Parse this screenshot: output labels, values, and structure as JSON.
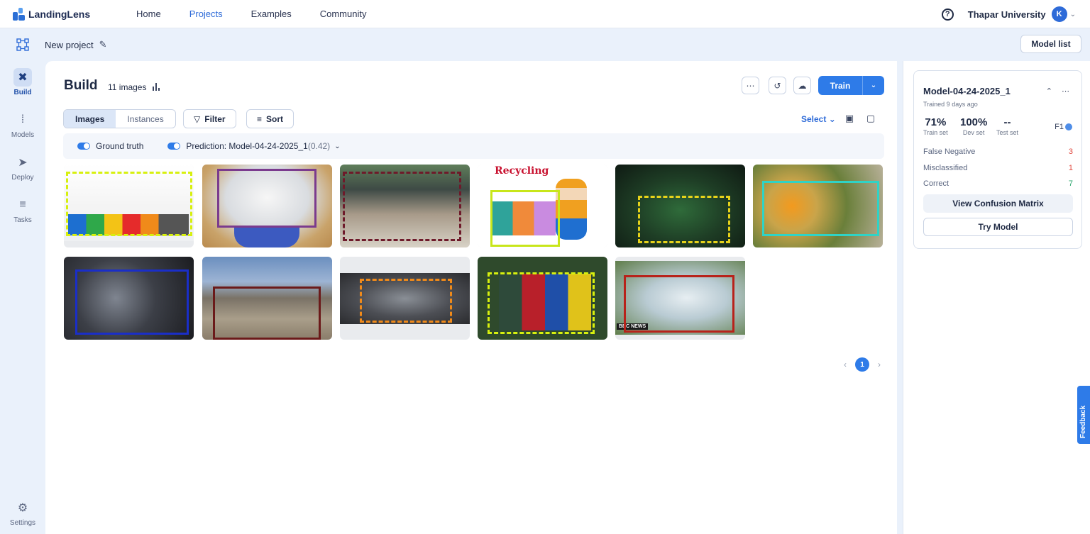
{
  "app": {
    "logo_text": "LandingLens",
    "nav": [
      "Home",
      "Projects",
      "Examples",
      "Community"
    ],
    "active_nav": "Projects",
    "org": "Thapar University",
    "avatar_initial": "K",
    "help_glyph": "?"
  },
  "project": {
    "name": "New project",
    "model_list_label": "Model list"
  },
  "sidebar": {
    "items": [
      {
        "label": "Build",
        "icon": "tools-icon",
        "active": true
      },
      {
        "label": "Models",
        "icon": "nodes-icon",
        "active": false
      },
      {
        "label": "Deploy",
        "icon": "rocket-icon",
        "active": false
      },
      {
        "label": "Tasks",
        "icon": "tasks-icon",
        "active": false
      }
    ],
    "settings_label": "Settings"
  },
  "build": {
    "title": "Build",
    "image_count": "11 images",
    "train_label": "Train",
    "view_tabs": [
      "Images",
      "Instances"
    ],
    "active_view": "Images",
    "filter_label": "Filter",
    "sort_label": "Sort",
    "select_label": "Select",
    "ground_truth_label": "Ground truth",
    "prediction_label": "Prediction: Model-04-24-2025_1",
    "prediction_score": "(0.42)",
    "page": "1"
  },
  "thumbnails": [
    {
      "name": "bins-rainbow",
      "caption": "",
      "box_color": "#d7f00f",
      "box_style": "dashed"
    },
    {
      "name": "paper-basket",
      "caption": "",
      "box_color": "#7b3b8e",
      "box_style": "solid"
    },
    {
      "name": "street-trash",
      "caption": "",
      "box_color": "#6e1a2a",
      "box_style": "dashed"
    },
    {
      "name": "recycling-cartoon",
      "caption": "Recycling",
      "box_color": "#c8e61a",
      "box_style": "solid"
    },
    {
      "name": "green-bottles",
      "caption": "",
      "box_color": "#e6d21a",
      "box_style": "dashed"
    },
    {
      "name": "fruit-compost",
      "caption": "",
      "box_color": "#2fd3c6",
      "box_style": "solid"
    },
    {
      "name": "metal-scrap",
      "caption": "",
      "box_color": "#1a2ec8",
      "box_style": "solid"
    },
    {
      "name": "landfill",
      "caption": "",
      "box_color": "#6b1a1a",
      "box_style": "solid"
    },
    {
      "name": "e-waste",
      "caption": "",
      "box_color": "#f08a1a",
      "box_style": "dashed"
    },
    {
      "name": "four-bins",
      "caption": "",
      "box_color": "#d7f00f",
      "box_style": "dashed"
    },
    {
      "name": "plastic-bottles",
      "caption": "BBC NEWS",
      "box_color": "#b8221a",
      "box_style": "solid"
    }
  ],
  "model_card": {
    "name": "Model-04-24-2025_1",
    "trained": "Trained 9 days ago",
    "metrics": [
      {
        "value": "71%",
        "label": "Train set"
      },
      {
        "value": "100%",
        "label": "Dev set"
      },
      {
        "value": "--",
        "label": "Test set"
      }
    ],
    "metric_type": "F1",
    "stats": [
      {
        "label": "False Negative",
        "value": "3",
        "color": "red"
      },
      {
        "label": "Misclassified",
        "value": "1",
        "color": "red"
      },
      {
        "label": "Correct",
        "value": "7",
        "color": "green"
      }
    ],
    "confusion_label": "View Confusion Matrix",
    "try_label": "Try Model"
  },
  "feedback_label": "Feedback",
  "colors": {
    "accent": "#2e7be8",
    "nav_active": "#2e6bd8",
    "error": "#e0483e",
    "success": "#2aa56c"
  }
}
